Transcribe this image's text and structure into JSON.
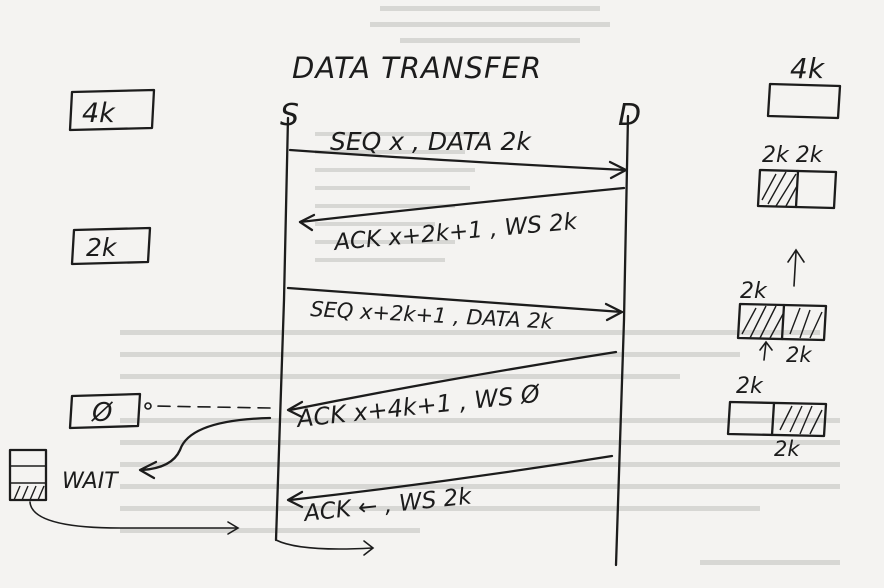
{
  "title": "DATA TRANSFER",
  "endpoints": {
    "sender": "S",
    "receiver": "D"
  },
  "messages": [
    {
      "text": "SEQ x , DATA 2k",
      "direction": "S-to-D"
    },
    {
      "text": "ACK x+2k+1 , WS 2k",
      "direction": "D-to-S"
    },
    {
      "text": "SEQ x+2k+1 , DATA 2k",
      "direction": "S-to-D"
    },
    {
      "text": "ACK x+4k+1 , WS Ø",
      "direction": "D-to-S"
    },
    {
      "text": "ACK ← , WS 2k",
      "direction": "D-to-S"
    }
  ],
  "sender_side": {
    "window_labels": [
      "4k",
      "2k",
      "Ø"
    ],
    "wait_label": "WAIT"
  },
  "receiver_buffers": [
    {
      "top_label": "4k",
      "filled_fraction": 0
    },
    {
      "top_label": "2k 2k",
      "filled_fraction": 0.5
    },
    {
      "top_label": "2k",
      "bottom_label": "2k",
      "filled_fraction": 1.0
    },
    {
      "top_label": "2k",
      "bottom_label": "2k",
      "filled_fraction": 0.5
    }
  ],
  "colors": {
    "ink": "#1c1c1c",
    "paper": "#f4f3f1"
  }
}
